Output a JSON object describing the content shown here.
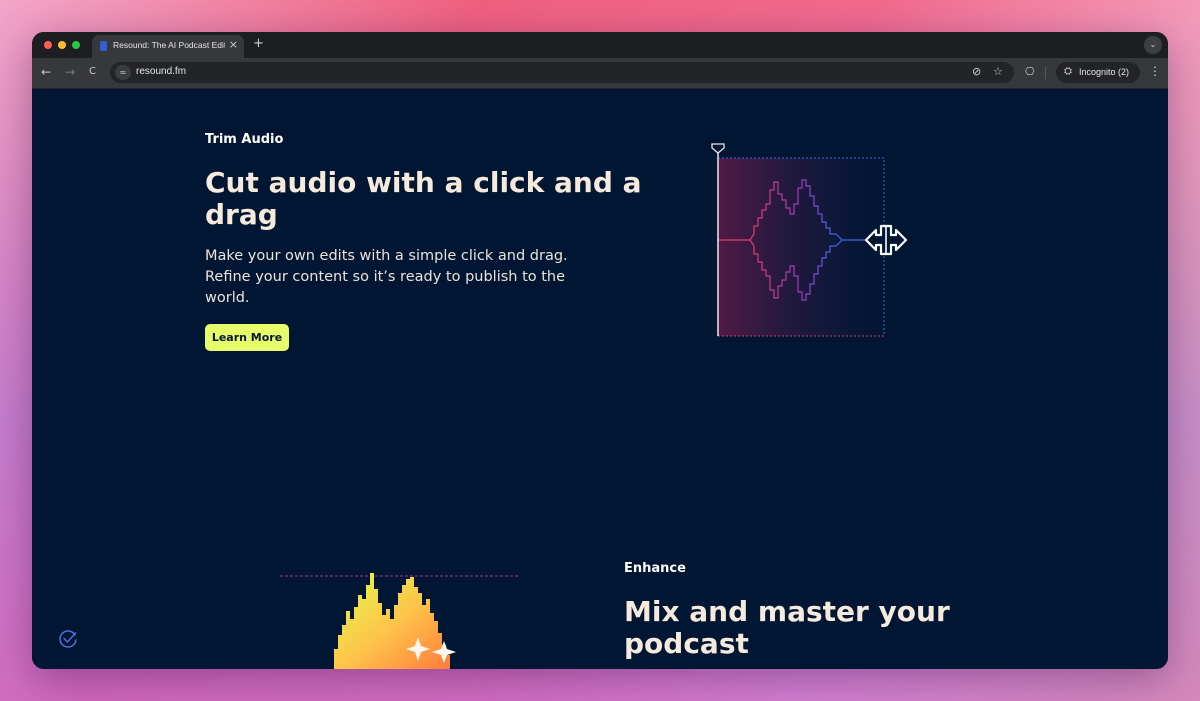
{
  "browser": {
    "tab_title": "Resound: The AI Podcast Editor",
    "tab_close": "×",
    "new_tab": "+",
    "url": "resound.fm",
    "incognito_label": "Incognito (2)",
    "nav_back": "←",
    "nav_forward": "→",
    "nav_reload": "C",
    "site_info_icon": "≈",
    "eye_off_icon": "⊘",
    "star_icon": "☆",
    "extensions_icon": "⎔",
    "incognito_icon": "⛭",
    "menu_icon": "⋮",
    "tab_menu_icon": "⌄"
  },
  "trim": {
    "eyebrow": "Trim Audio",
    "headline_line1": "Cut audio with a click and a",
    "headline_line2": "drag",
    "body_line1": "Make your own edits with a simple click and drag.",
    "body_line2": "Refine your content so it’s ready to publish to the",
    "body_line3": "world.",
    "cta": "Learn More"
  },
  "enhance": {
    "eyebrow": "Enhance",
    "headline_line1": "Mix and master your",
    "headline_line2": "podcast"
  },
  "colors": {
    "page_bg": "#011632",
    "cta_bg": "#e7fc6b",
    "headline": "#f6eadd",
    "wave_pink": "#e23b6e",
    "wave_blue": "#3e67e6",
    "bars_yellow": "#e3ff4a",
    "bars_orange": "#ff7a3c"
  }
}
